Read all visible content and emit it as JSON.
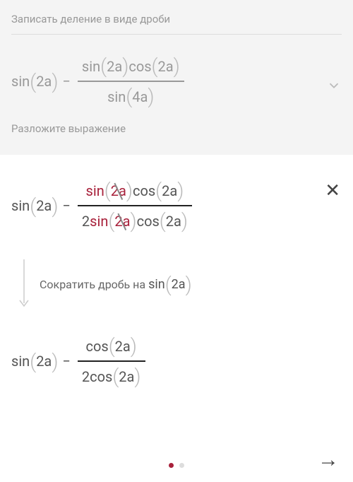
{
  "faded": {
    "title1": "Записать деление в виде дроби",
    "title2": "Разложите выражение",
    "expr": {
      "left_fn": "sin",
      "left_arg": "2a",
      "minus": "−",
      "num_fn1": "sin",
      "num_arg1": "2a",
      "num_fn2": "cos",
      "num_arg2": "2a",
      "den_fn": "sin",
      "den_arg": "4a"
    }
  },
  "active": {
    "expr1": {
      "left_fn": "sin",
      "left_arg": "2a",
      "minus": "−",
      "num_fn1": "sin",
      "num_arg1": "2a",
      "num_fn2": "cos",
      "num_arg2": "2a",
      "den_coef": "2",
      "den_fn1": "sin",
      "den_arg1": "2a",
      "den_fn2": "cos",
      "den_arg2": "2a"
    },
    "hint_text": "Сократить дробь на",
    "hint_fn": "sin",
    "hint_arg": "2a",
    "expr2": {
      "left_fn": "sin",
      "left_arg": "2a",
      "minus": "−",
      "num_fn": "cos",
      "num_arg": "2a",
      "den_coef": "2",
      "den_fn": "cos",
      "den_arg": "2a"
    }
  },
  "icons": {
    "close": "✕",
    "next": "→"
  }
}
